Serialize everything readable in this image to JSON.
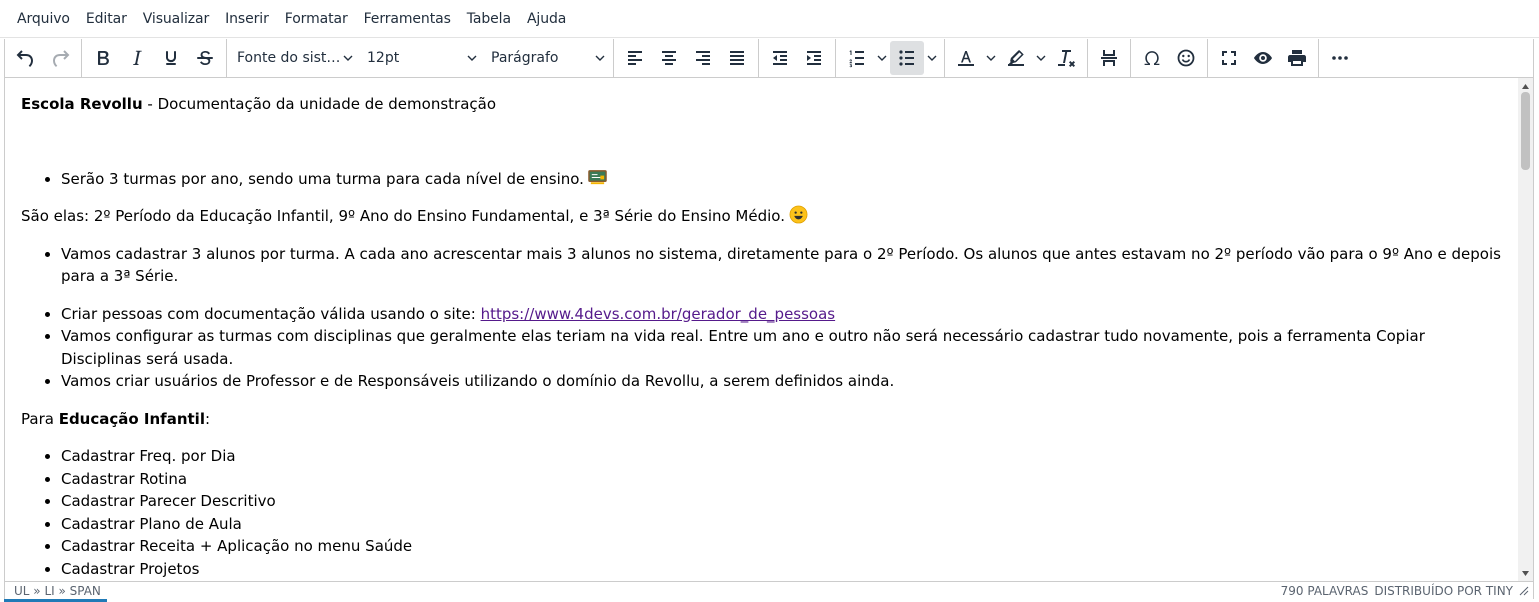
{
  "menubar": {
    "items": [
      "Arquivo",
      "Editar",
      "Visualizar",
      "Inserir",
      "Formatar",
      "Ferramentas",
      "Tabela",
      "Ajuda"
    ]
  },
  "toolbar": {
    "font_family": "Fonte do sist…",
    "font_size": "12pt",
    "block_format": "Parágrafo",
    "active_button": "bullet-list"
  },
  "document": {
    "title_bold": "Escola Revollu",
    "title_rest": " - Documentação da unidade de demonstração",
    "list1": [
      "Serão 3 turmas por ano, sendo uma turma para cada nível de ensino."
    ],
    "para1": "São elas: 2º Período da Educação Infantil, 9º Ano do Ensino Fundamental, e 3ª Série do Ensino Médio.",
    "list2": [
      "Vamos cadastrar 3 alunos por turma. A cada ano acrescentar mais 3 alunos no sistema, diretamente para o 2º Período. Os alunos que antes estavam no 2º período vão para o 9º Ano e depois para a 3ª Série."
    ],
    "list3_item1_text": "Criar pessoas com documentação válida usando o site: ",
    "list3_item1_link": "https://www.4devs.com.br/gerador_de_pessoas",
    "list3_rest": [
      "Vamos configurar as turmas com disciplinas que geralmente elas teriam na vida real. Entre um ano e outro não será necessário cadastrar tudo novamente, pois a ferramenta Copiar Disciplinas será usada.",
      "Vamos criar usuários de Professor e de Responsáveis utilizando o domínio da Revollu, a serem definidos ainda."
    ],
    "para2_prefix": "Para ",
    "para2_bold": "Educação Infantil",
    "para2_suffix": ":",
    "list4": [
      "Cadastrar Freq. por Dia",
      "Cadastrar Rotina",
      "Cadastrar Parecer Descritivo",
      "Cadastrar Plano de Aula",
      "Cadastrar Receita + Aplicação no menu Saúde",
      "Cadastrar Projetos"
    ]
  },
  "statusbar": {
    "path": "UL » LI » SPAN",
    "word_count": "790 PALAVRAS",
    "branding": "DISTRIBUÍDO POR TINY"
  },
  "colors": {
    "link": "#551a8b",
    "active_button_bg": "#dee0e2",
    "progress": "#207ab7"
  }
}
